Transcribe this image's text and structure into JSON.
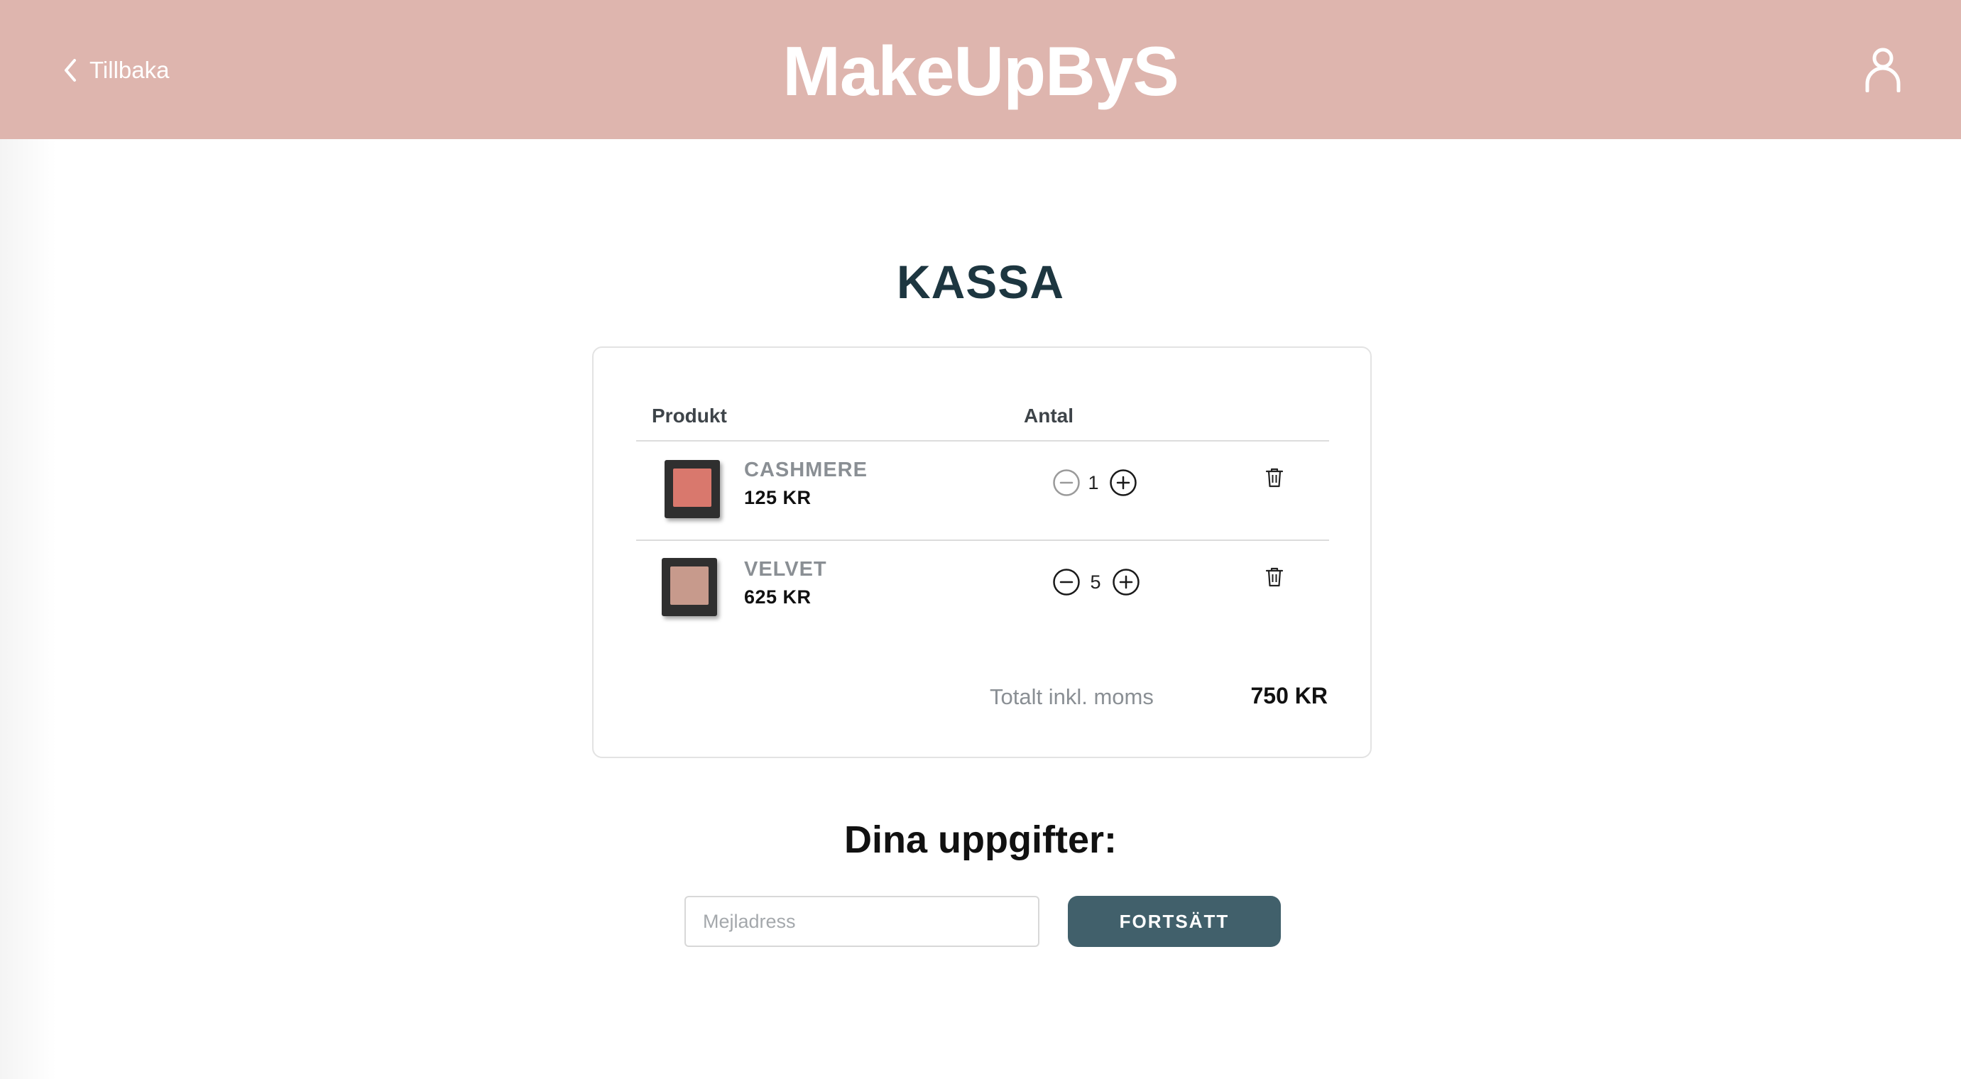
{
  "header": {
    "back_label": "Tillbaka",
    "brand": "MakeUpByS",
    "back_icon": "chevron-left-icon",
    "user_icon": "user-icon",
    "background_color": "#deb5ae"
  },
  "page_title": "KASSA",
  "cart": {
    "columns": {
      "product": "Produkt",
      "quantity": "Antal"
    },
    "items": [
      {
        "name": "CASHMERE",
        "price": "125 KR",
        "quantity": "1",
        "swatch_color": "#d9786d"
      },
      {
        "name": "VELVET",
        "price": "625 KR",
        "quantity": "5",
        "swatch_color": "#c79a8c"
      }
    ],
    "total_label": "Totalt inkl. moms",
    "total_value": "750 KR"
  },
  "details": {
    "title": "Dina uppgifter:",
    "email_placeholder": "Mejladress",
    "email_value": "",
    "continue_label": "FORTSÄTT",
    "button_color": "#41606b"
  }
}
